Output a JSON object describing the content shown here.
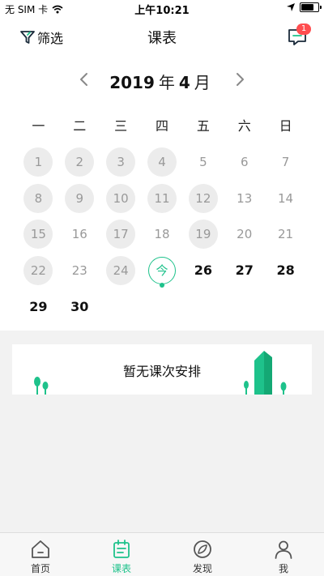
{
  "status_bar": {
    "carrier": "无 SIM 卡",
    "time": "上午10:21",
    "battery_level": 0.85
  },
  "nav": {
    "filter_label": "筛选",
    "title": "课表",
    "message_badge": "1"
  },
  "calendar": {
    "year": "2019",
    "year_unit": "年",
    "month": "4",
    "month_unit": "月",
    "weekdays": [
      "一",
      "二",
      "三",
      "四",
      "五",
      "六",
      "日"
    ],
    "days": [
      {
        "label": "1",
        "state": "past-course"
      },
      {
        "label": "2",
        "state": "past-course"
      },
      {
        "label": "3",
        "state": "past-course"
      },
      {
        "label": "4",
        "state": "past-course"
      },
      {
        "label": "5",
        "state": "past"
      },
      {
        "label": "6",
        "state": "past"
      },
      {
        "label": "7",
        "state": "past"
      },
      {
        "label": "8",
        "state": "past-course"
      },
      {
        "label": "9",
        "state": "past-course"
      },
      {
        "label": "10",
        "state": "past-course"
      },
      {
        "label": "11",
        "state": "past-course"
      },
      {
        "label": "12",
        "state": "past-course"
      },
      {
        "label": "13",
        "state": "past"
      },
      {
        "label": "14",
        "state": "past"
      },
      {
        "label": "15",
        "state": "past-course"
      },
      {
        "label": "16",
        "state": "past"
      },
      {
        "label": "17",
        "state": "past-course"
      },
      {
        "label": "18",
        "state": "past"
      },
      {
        "label": "19",
        "state": "past-course"
      },
      {
        "label": "20",
        "state": "past"
      },
      {
        "label": "21",
        "state": "past"
      },
      {
        "label": "22",
        "state": "past-course"
      },
      {
        "label": "23",
        "state": "past"
      },
      {
        "label": "24",
        "state": "past-course"
      },
      {
        "label": "今",
        "state": "today"
      },
      {
        "label": "26",
        "state": "future"
      },
      {
        "label": "27",
        "state": "future"
      },
      {
        "label": "28",
        "state": "future"
      },
      {
        "label": "29",
        "state": "future"
      },
      {
        "label": "30",
        "state": "future"
      }
    ]
  },
  "empty_state": {
    "text": "暂无课次安排"
  },
  "tabs": [
    {
      "label": "首页",
      "icon": "home-icon",
      "active": false
    },
    {
      "label": "课表",
      "icon": "schedule-icon",
      "active": true
    },
    {
      "label": "发现",
      "icon": "discover-icon",
      "active": false
    },
    {
      "label": "我",
      "icon": "profile-icon",
      "active": false
    }
  ],
  "colors": {
    "accent": "#1ec28b",
    "badge": "#ff4d4f",
    "course_day_bg": "#ececec"
  }
}
